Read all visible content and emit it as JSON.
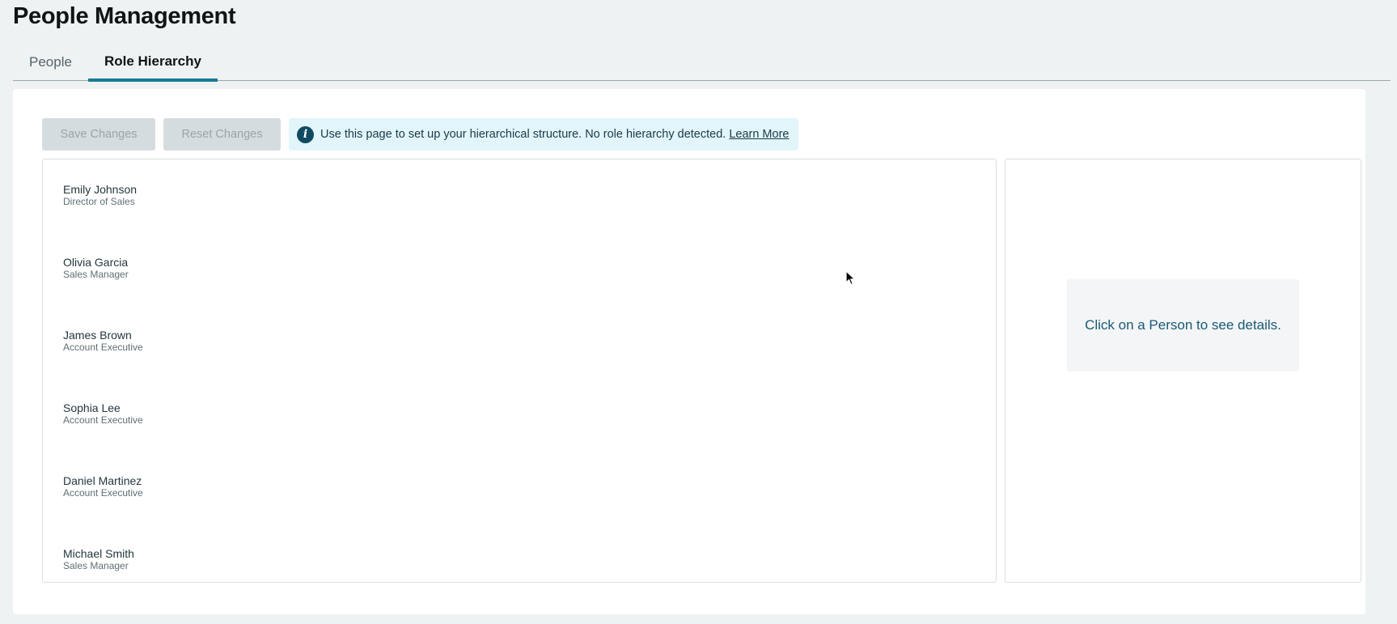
{
  "page": {
    "title": "People Management"
  },
  "tabs": [
    {
      "label": "People",
      "active": false
    },
    {
      "label": "Role Hierarchy",
      "active": true
    }
  ],
  "toolbar": {
    "save_label": "Save Changes",
    "reset_label": "Reset Changes",
    "save_disabled": true,
    "reset_disabled": true
  },
  "banner": {
    "icon": "info-icon",
    "text": "Use this page to set up your hierarchical structure. No role hierarchy detected.",
    "link_label": "Learn More"
  },
  "people": [
    {
      "name": "Emily Johnson",
      "role": "Director of Sales"
    },
    {
      "name": "Olivia Garcia",
      "role": "Sales Manager"
    },
    {
      "name": "James Brown",
      "role": "Account Executive"
    },
    {
      "name": "Sophia Lee",
      "role": "Account Executive"
    },
    {
      "name": "Daniel Martinez",
      "role": "Account Executive"
    },
    {
      "name": "Michael Smith",
      "role": "Sales Manager"
    }
  ],
  "details": {
    "placeholder": "Click on a Person to see details."
  },
  "colors": {
    "background": "#eef2f2",
    "accent": "#167a9b",
    "banner_bg": "#e1f5fb",
    "info_icon": "#0e4b60",
    "disabled_button": "#d5dcdf"
  }
}
